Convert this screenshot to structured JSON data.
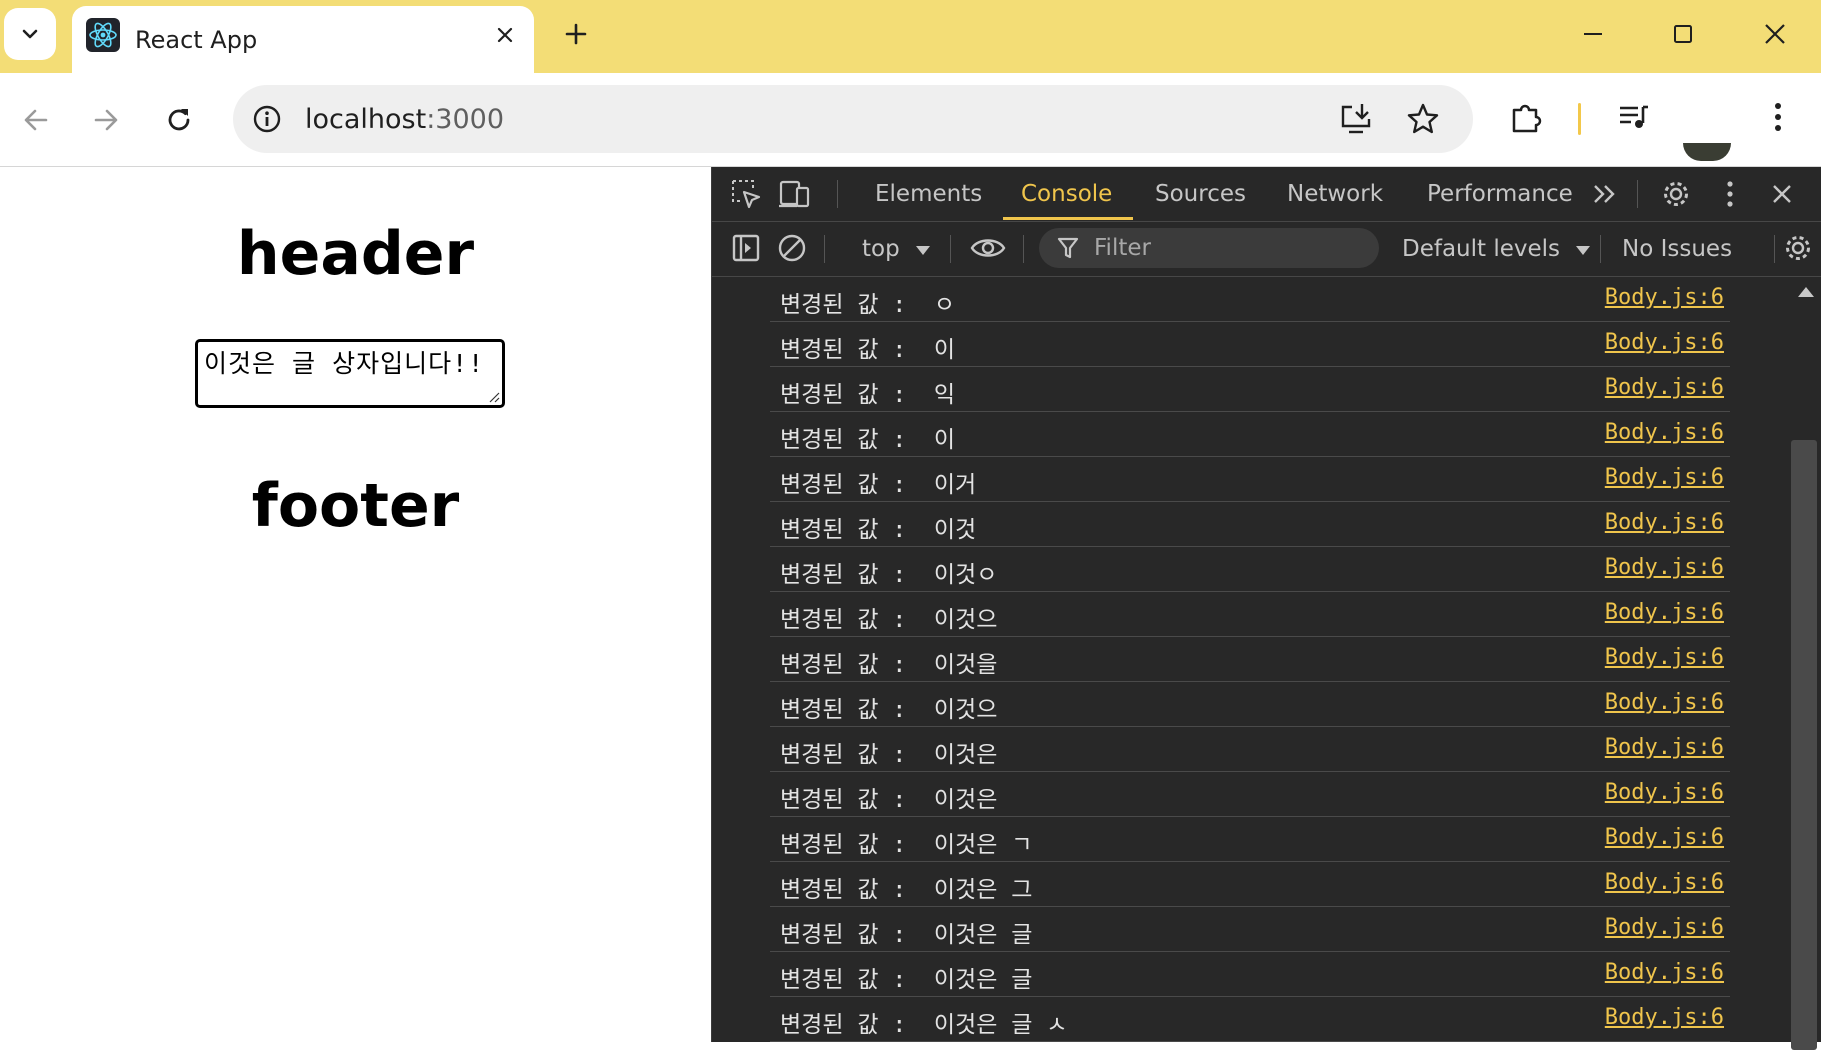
{
  "browser": {
    "tab_title": "React App",
    "url_host": "localhost",
    "url_port": ":3000"
  },
  "page": {
    "header": "header",
    "textarea_value": "이것은 글 상자입니다!!",
    "footer": "footer"
  },
  "devtools": {
    "tabs": [
      "Elements",
      "Console",
      "Sources",
      "Network",
      "Performance"
    ],
    "active_tab": "Console",
    "context": "top",
    "filter_placeholder": "Filter",
    "levels": "Default levels",
    "issues": "No Issues",
    "accent_color": "#f0c54c",
    "logs": [
      {
        "msg": "변경된 값 :  ㅇ",
        "src": "Body.js:6"
      },
      {
        "msg": "변경된 값 :  이",
        "src": "Body.js:6"
      },
      {
        "msg": "변경된 값 :  익",
        "src": "Body.js:6"
      },
      {
        "msg": "변경된 값 :  이",
        "src": "Body.js:6"
      },
      {
        "msg": "변경된 값 :  이거",
        "src": "Body.js:6"
      },
      {
        "msg": "변경된 값 :  이것",
        "src": "Body.js:6"
      },
      {
        "msg": "변경된 값 :  이것ㅇ",
        "src": "Body.js:6"
      },
      {
        "msg": "변경된 값 :  이것으",
        "src": "Body.js:6"
      },
      {
        "msg": "변경된 값 :  이것을",
        "src": "Body.js:6"
      },
      {
        "msg": "변경된 값 :  이것으",
        "src": "Body.js:6"
      },
      {
        "msg": "변경된 값 :  이것은",
        "src": "Body.js:6"
      },
      {
        "msg": "변경된 값 :  이것은",
        "src": "Body.js:6"
      },
      {
        "msg": "변경된 값 :  이것은 ㄱ",
        "src": "Body.js:6"
      },
      {
        "msg": "변경된 값 :  이것은 그",
        "src": "Body.js:6"
      },
      {
        "msg": "변경된 값 :  이것은 글",
        "src": "Body.js:6"
      },
      {
        "msg": "변경된 값 :  이것은 글",
        "src": "Body.js:6"
      },
      {
        "msg": "변경된 값 :  이것은 글 ㅅ",
        "src": "Body.js:6"
      }
    ]
  },
  "icons": {
    "tab_list": "chevron-down-icon",
    "favicon": "react-logo-icon",
    "close": "close-icon",
    "new_tab": "plus-icon",
    "back": "arrow-left-icon",
    "forward": "arrow-right-icon",
    "reload": "reload-icon",
    "site_info": "info-icon",
    "install": "install-app-icon",
    "bookmark": "star-icon",
    "extensions": "puzzle-icon",
    "media": "media-control-icon",
    "menu": "kebab-menu-icon",
    "inspect": "inspect-element-icon",
    "device": "device-toolbar-icon",
    "more_tabs": "double-chevron-icon",
    "settings": "gear-icon",
    "sidebar": "sidebar-toggle-icon",
    "clear": "clear-console-icon",
    "eye": "eye-icon",
    "filter": "filter-icon"
  }
}
